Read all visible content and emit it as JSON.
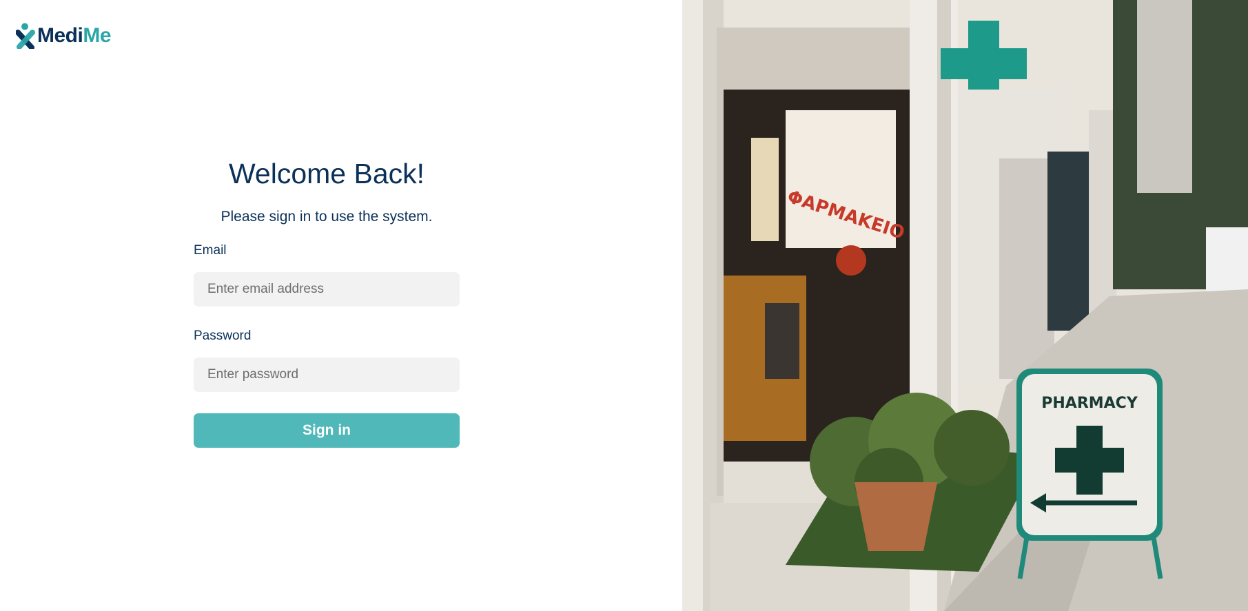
{
  "brand": {
    "part1": "Medi",
    "part2": "Me"
  },
  "login": {
    "title": "Welcome Back!",
    "subtitle": "Please sign in to use the system.",
    "email_label": "Email",
    "email_placeholder": "Enter email address",
    "email_value": "",
    "password_label": "Password",
    "password_placeholder": "Enter password",
    "password_value": "",
    "submit_label": "Sign in"
  },
  "photo": {
    "sign_text": "PHARMACY",
    "window_text": "ΦΑΡΜΑΚΕΙΟ"
  },
  "colors": {
    "navy": "#0c3159",
    "teal": "#2aa6a8",
    "button": "#50b8b8",
    "input_bg": "#f2f2f2"
  }
}
